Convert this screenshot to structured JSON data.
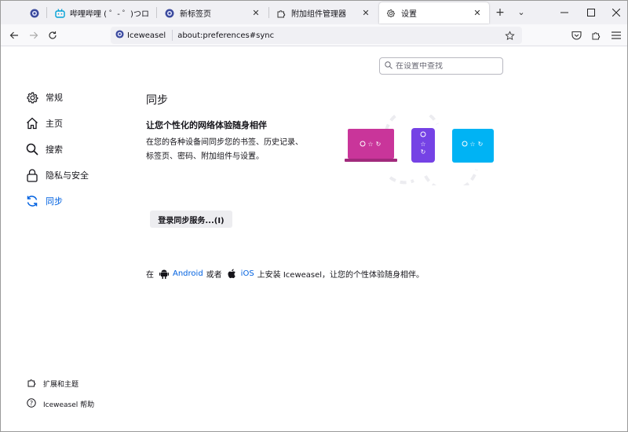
{
  "tabs": [
    {
      "label": "",
      "icon": "iceweasel-icon"
    },
    {
      "label": "哔哩哔哩 ( ゜- ゜)つロ 干杯~",
      "icon": "bilibili-icon"
    },
    {
      "label": "新标签页",
      "icon": "iceweasel-icon"
    },
    {
      "label": "附加组件管理器",
      "icon": "puzzle-icon"
    },
    {
      "label": "设置",
      "icon": "gear-icon"
    }
  ],
  "urlbar": {
    "identity_label": "Iceweasel",
    "url": "about:preferences#sync"
  },
  "search": {
    "placeholder": "在设置中查找"
  },
  "sidebar": {
    "items": [
      {
        "label": "常规",
        "icon": "gear-icon"
      },
      {
        "label": "主页",
        "icon": "home-icon"
      },
      {
        "label": "搜索",
        "icon": "search-icon"
      },
      {
        "label": "隐私与安全",
        "icon": "lock-icon"
      },
      {
        "label": "同步",
        "icon": "sync-icon",
        "selected": true
      }
    ],
    "footer": [
      {
        "label": "扩展和主题",
        "icon": "puzzle-icon"
      },
      {
        "label": "Iceweasel 帮助",
        "icon": "help-icon"
      }
    ]
  },
  "main": {
    "title": "同步",
    "heading": "让您个性化的网络体验随身相伴",
    "desc_line1": "在您的各种设备间同步您的书签、历史记录、",
    "desc_line2": "标签页、密码、附加组件与设置。",
    "signin_button": "登录同步服务...(I)",
    "apps": {
      "prefix": "在",
      "android": "Android",
      "or": "或者",
      "ios": "iOS",
      "suffix": "上安装 Iceweasel，让您的个性体验随身相伴。"
    }
  },
  "colors": {
    "accent": "#0061e0",
    "laptop": "#c9359a",
    "phone": "#7542e5",
    "tablet": "#00b3f4"
  }
}
